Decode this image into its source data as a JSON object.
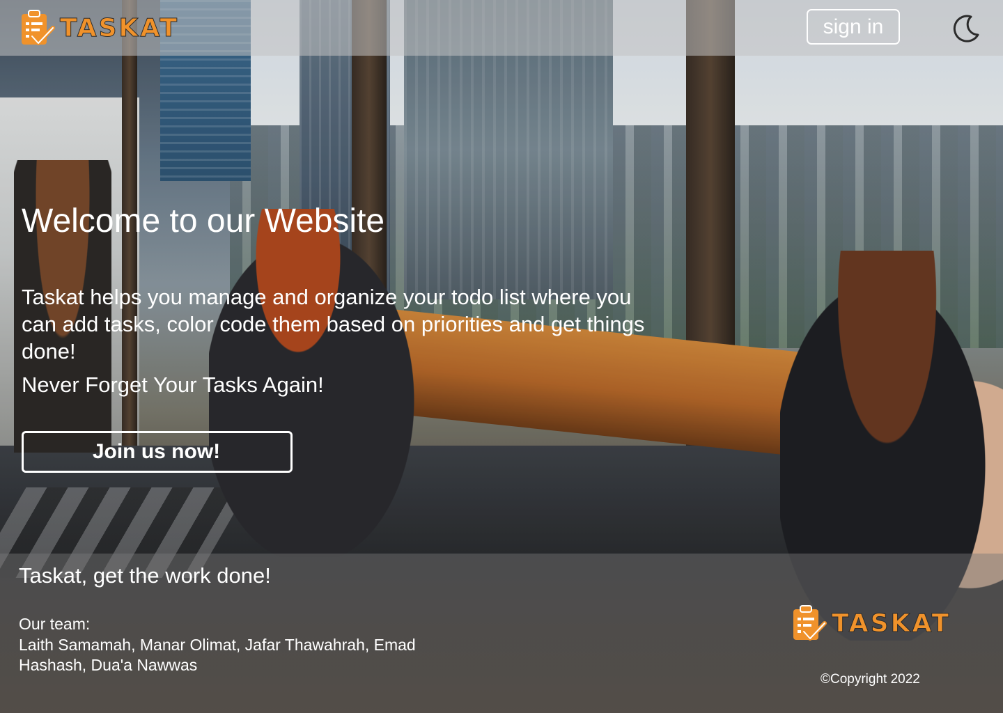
{
  "header": {
    "brand_name": "TASKAT",
    "logo_icon": "clipboard-check-icon",
    "sign_in_label": "sign in",
    "theme_icon": "moon-icon"
  },
  "hero": {
    "title": "Welcome to our Website",
    "description": "Taskat helps you manage and organize your todo list where you can add tasks, color code them based on priorities and get things done!",
    "tagline": "Never Forget Your Tasks Again!",
    "cta_label": "Join us now!"
  },
  "footer": {
    "tagline": "Taskat, get the work done!",
    "team_label": "Our team:",
    "team_members": "Laith Samamah, Manar Olimat, Jafar Thawahrah, Emad Hashash, Dua'a Nawwas",
    "brand_name": "TASKAT",
    "copyright": "©Copyright 2022"
  },
  "colors": {
    "brand_orange": "#f0922b",
    "text": "#ffffff",
    "header_overlay": "rgba(195,195,195,.55)",
    "footer_overlay": "rgba(120,120,120,.45)"
  }
}
